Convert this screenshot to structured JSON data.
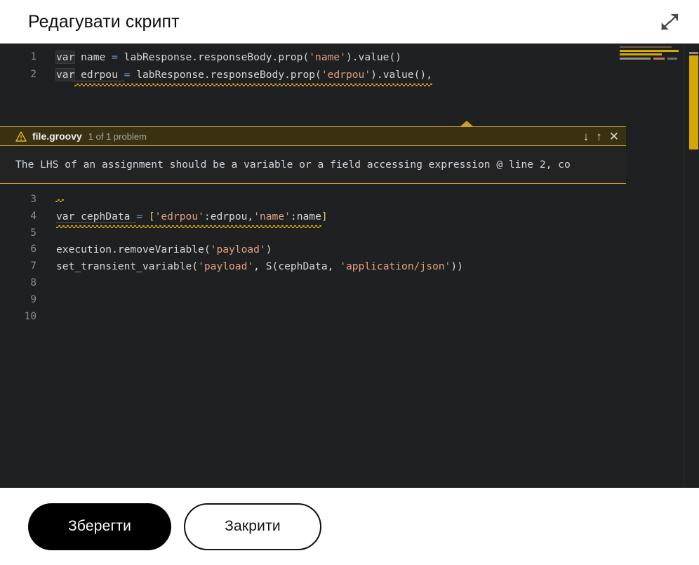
{
  "dialog": {
    "title": "Редагувати скрипт",
    "expand_icon": "expand-diagonal-icon"
  },
  "editor": {
    "language": "groovy",
    "line_numbers": [
      "1",
      "2",
      "3",
      "4",
      "5",
      "6",
      "7",
      "8",
      "9",
      "10"
    ],
    "lines": [
      {
        "num": "1",
        "text": "var name = labResponse.responseBody.prop('name').value()"
      },
      {
        "num": "2",
        "text": "var edrpou = labResponse.responseBody.prop('edrpou').value(),"
      },
      {
        "num": "3",
        "text": ""
      },
      {
        "num": "4",
        "text": "var cephData = ['edrpou':edrpou,'name':name]"
      },
      {
        "num": "5",
        "text": ""
      },
      {
        "num": "6",
        "text": "execution.removeVariable('payload')"
      },
      {
        "num": "7",
        "text": "set_transient_variable('payload', S(cephData, 'application/json'))"
      },
      {
        "num": "8",
        "text": ""
      },
      {
        "num": "9",
        "text": ""
      },
      {
        "num": "10",
        "text": ""
      }
    ],
    "tokens": {
      "l1_var": "var",
      "l1_name": " name ",
      "l1_eq": "=",
      "l1_chain": " labResponse.responseBody.prop(",
      "l1_str": "'name'",
      "l1_tail": ").value()",
      "l2_var": "var",
      "l2_name": " edrpou ",
      "l2_eq": "=",
      "l2_chain": " labResponse.responseBody.prop(",
      "l2_str": "'edrpou'",
      "l2_tail": ").value(),",
      "l4_var": "var",
      "l4_name": " cephData ",
      "l4_eq": "=",
      "l4_open": " [",
      "l4_str1": "'edrpou'",
      "l4_mid1": ":edrpou,",
      "l4_str2": "'name'",
      "l4_mid2": ":name",
      "l4_close": "]",
      "l6_a": "execution.removeVariable(",
      "l6_str": "'payload'",
      "l6_b": ")",
      "l7_a": "set_transient_variable(",
      "l7_str1": "'payload'",
      "l7_b": ", S(cephData, ",
      "l7_str2": "'application/json'",
      "l7_c": "))"
    }
  },
  "problem_panel": {
    "severity_icon": "warning-triangle-icon",
    "file": "file.groovy",
    "count": "1 of 1 problem",
    "message": "The LHS of an assignment should be a variable or a field accessing expression @ line 2, co",
    "actions": {
      "next": "↓",
      "previous": "↑",
      "close": "✕"
    }
  },
  "footer": {
    "save_label": "Зберегти",
    "close_label": "Закрити"
  },
  "colors": {
    "editor_bg": "#1f2021",
    "accent_warning": "#c9a227",
    "string_token": "#e0a080",
    "operator_token": "#6f9fd8",
    "scrollbar": "#d4a800",
    "primary_button": "#000000"
  }
}
